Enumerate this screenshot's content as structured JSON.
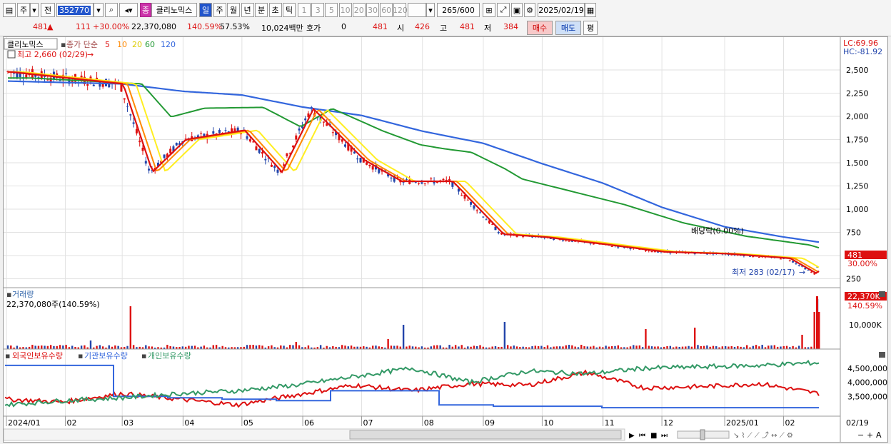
{
  "toolbar": {
    "market_sel": "주",
    "type_sel": "전",
    "code": "352770",
    "stock_badge": "종",
    "stock_name": "클리노믹스",
    "periods": [
      "일",
      "주",
      "월",
      "년",
      "분",
      "초",
      "틱"
    ],
    "active_period": "일",
    "intervals": [
      "1",
      "3",
      "5",
      "10",
      "20",
      "30",
      "60",
      "120"
    ],
    "count": "265",
    "count_total": "/600",
    "date": "2025/02/19"
  },
  "quote": {
    "price": "481",
    "change": "111",
    "change_pct": "+30.00%",
    "volume": "22,370,080",
    "volume_ratio": "140.59%",
    "turnover": "57.53%",
    "amount": "10,024백만",
    "hoga_label": "호가",
    "hoga_value": "0",
    "hoga_price": "481",
    "open_label": "시",
    "open": "426",
    "high_label": "고",
    "high": "481",
    "low_label": "저",
    "low": "384",
    "buy_button": "매수",
    "sell_button": "매도",
    "eval_button": "평"
  },
  "main_panel": {
    "stock_name": "클리노믹스",
    "ma_label": "종가 단순",
    "ma_periods": [
      "5",
      "10",
      "20",
      "60",
      "120"
    ],
    "high_annotation": "최고 2,660 (02/29)",
    "low_annotation": "최저 283 (02/17)",
    "dividend_annotation": "배당락(0.00%)",
    "lc_label": "LC:69.96",
    "hc_label": "HC:-81.92",
    "current_price_tag": "481",
    "current_pct_tag": "30.00%"
  },
  "volume_panel": {
    "title": "거래량",
    "value_label": "22,370,080주(140.59%)",
    "tag_value": "22,370K",
    "tag_pct": "140.59%",
    "y_tick": "10,000K"
  },
  "holding_panel": {
    "series_labels": [
      "외국인보유수량",
      "기관보유수량",
      "개인보유수량"
    ]
  },
  "x_axis": {
    "labels": [
      "2024/01",
      "02",
      "03",
      "04",
      "05",
      "06",
      "07",
      "08",
      "09",
      "10",
      "11",
      "12",
      "2025/01",
      "02"
    ],
    "right_label": "02/19"
  },
  "colors": {
    "ma5": "#dd1111",
    "ma10": "#ff8800",
    "ma20": "#ffee22",
    "ma60": "#229933",
    "ma120": "#3366dd",
    "up": "#dd1111",
    "down": "#2244aa",
    "foreign": "#dd1111",
    "institution": "#3366dd",
    "individual": "#339966"
  },
  "chart_data": [
    {
      "type": "line",
      "title": "클리노믹스",
      "series": [
        {
          "name": "5",
          "x": [
            "2024/01/02",
            "2024/02/29",
            "2024/03/15",
            "2024/04/01",
            "2024/05/01",
            "2024/05/20",
            "2024/06/05",
            "2024/07/01",
            "2024/07/20",
            "2024/08/15",
            "2024/09/10",
            "2024/10/01",
            "2024/11/01",
            "2024/12/01",
            "2025/01/02",
            "2025/02/03",
            "2025/02/17",
            "2025/02/19"
          ],
          "values": [
            2480,
            2350,
            1400,
            1750,
            1850,
            1400,
            2080,
            1530,
            1300,
            1300,
            730,
            700,
            620,
            540,
            520,
            470,
            300,
            420
          ]
        },
        {
          "name": "120",
          "x": [
            "2024/01/02",
            "2024/03/01",
            "2024/04/01",
            "2024/05/01",
            "2024/06/01",
            "2024/07/01",
            "2024/08/01",
            "2024/09/01",
            "2024/10/01",
            "2024/11/01",
            "2024/12/01",
            "2025/01/02",
            "2025/02/01",
            "2025/02/19"
          ],
          "values": [
            2380,
            2350,
            2270,
            2230,
            2100,
            2010,
            1840,
            1710,
            1490,
            1280,
            1020,
            810,
            700,
            645
          ]
        }
      ],
      "ylim": [
        200,
        2700
      ],
      "y_ticks": [
        250,
        500,
        750,
        1000,
        1250,
        1500,
        1750,
        2000,
        2250,
        2500
      ],
      "high": {
        "value": 2660,
        "date": "02/29"
      },
      "low": {
        "value": 283,
        "date": "02/17"
      }
    },
    {
      "type": "bar",
      "title": "거래량",
      "values_label": "22,370,080주(140.59%)",
      "y_ticks": [
        "10,000K"
      ]
    },
    {
      "type": "line",
      "title": "보유수량",
      "series": [
        {
          "name": "외국인보유수량",
          "values": [
            3400000,
            3300000,
            3600000,
            3400000,
            3200000,
            3550000,
            3900000,
            3700000,
            3950000,
            3900000,
            4350000,
            3800000,
            3850000,
            3950000,
            3600000
          ]
        },
        {
          "name": "기관보유수량",
          "values": [
            4600000,
            4600000,
            3500000,
            3450000,
            3400000,
            3350000,
            3700000,
            3700000,
            3200000,
            3150000,
            3150000,
            3100000,
            3100000,
            3100000,
            3100000
          ]
        },
        {
          "name": "개인보유수량",
          "values": [
            3200000,
            3350000,
            3450000,
            3600000,
            3700000,
            3900000,
            4200000,
            4500000,
            4000000,
            4400000,
            4300000,
            4500000,
            4550000,
            4600000,
            4700000
          ]
        }
      ],
      "y_ticks": [
        3500000,
        4000000,
        4500000
      ]
    }
  ]
}
